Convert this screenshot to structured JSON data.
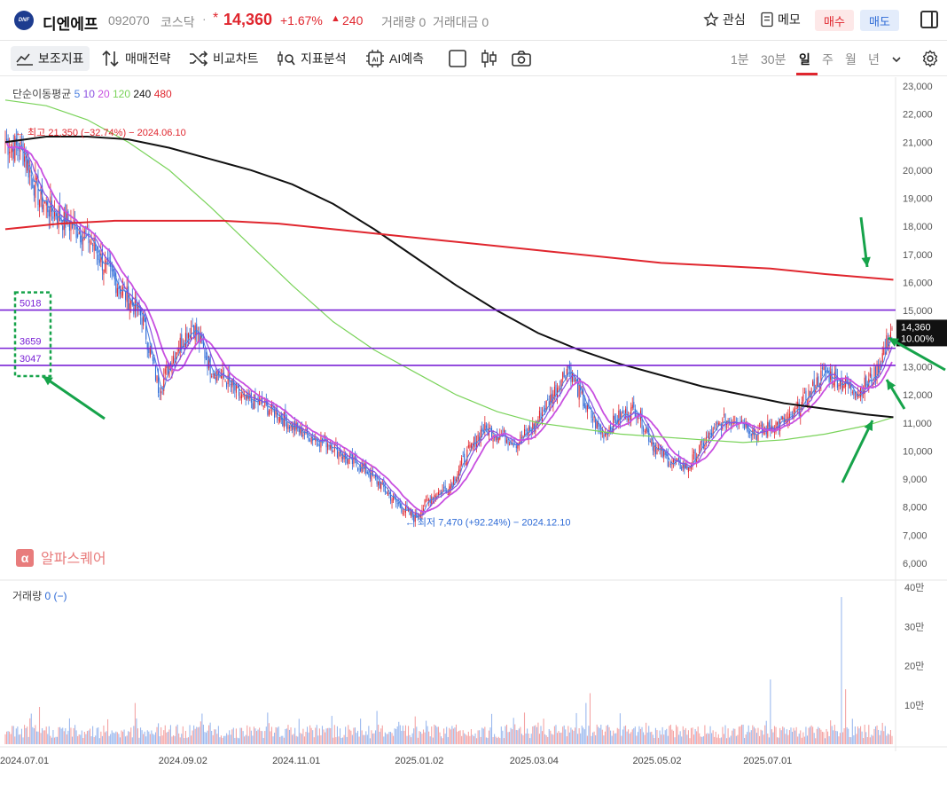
{
  "header": {
    "logo_text": "DNF",
    "stock_name": "디엔에프",
    "stock_code": "092070",
    "market": "코스닥",
    "separator": "·",
    "price_prefix": "*",
    "price": "14,360",
    "change_pct": "+1.67%",
    "change_arrow": "▲",
    "change": "240",
    "volume_text": "거래량 0",
    "amount_text": "거래대금 0",
    "watch_label": "관심",
    "memo_label": "메모",
    "buy_label": "매수",
    "sell_label": "매도"
  },
  "toolbar": {
    "indicator_label": "보조지표",
    "strategy_label": "매매전략",
    "compare_label": "비교차트",
    "analysis_label": "지표분석",
    "ai_label": "AI예측",
    "ai_icon_text": "AI",
    "timeframes": [
      "1분",
      "30분",
      "일",
      "주",
      "월",
      "년"
    ],
    "active_timeframe": "일"
  },
  "chart_data": {
    "type": "candlestick",
    "ma_legend": {
      "title": "단순이동평균",
      "periods": [
        {
          "label": "5",
          "color": "#4a7fe0"
        },
        {
          "label": "10",
          "color": "#8a4fe0"
        },
        {
          "label": "20",
          "color": "#c84fe0"
        },
        {
          "label": "120",
          "color": "#7ad35a"
        },
        {
          "label": "240",
          "color": "#111111"
        },
        {
          "label": "480",
          "color": "#e0262e"
        }
      ]
    },
    "ylim": [
      6000,
      23000
    ],
    "y_ticks": [
      "23,000",
      "22,000",
      "21,000",
      "20,000",
      "19,000",
      "18,000",
      "17,000",
      "16,000",
      "15,000",
      "14,000",
      "13,000",
      "12,000",
      "11,000",
      "10,000",
      "9,000",
      "8,000",
      "7,000",
      "6,000"
    ],
    "x_ticks": [
      "2024.07.01",
      "2024.09.02",
      "2024.11.01",
      "2025.01.02",
      "2025.03.04",
      "2025.05.02",
      "2025.07.01"
    ],
    "current_price_label": "14,360",
    "current_pct_label": "10.00%",
    "high_annotation": "최고 21,350 (−32.74%) − 2024.06.10",
    "low_annotation": "최저 7,470 (+92.24%) − 2024.12.10",
    "horizontal_lines": [
      {
        "label": "5018",
        "value": 15018
      },
      {
        "label": "3659",
        "value": 13659
      },
      {
        "label": "3047",
        "value": 13047
      }
    ],
    "close_anchors": [
      21000,
      20700,
      19000,
      18400,
      18000,
      17500,
      16400,
      15600,
      14800,
      12200,
      13600,
      14500,
      13000,
      12500,
      11800,
      11700,
      11300,
      10800,
      10500,
      10300,
      9700,
      9400,
      8800,
      8100,
      7600,
      8400,
      8700,
      9800,
      10800,
      10600,
      10300,
      10900,
      11900,
      13000,
      11600,
      10600,
      11200,
      11500,
      10200,
      9600,
      9400,
      10300,
      11000,
      11200,
      10600,
      10900,
      11100,
      11900,
      12800,
      12500,
      12100,
      12700,
      14360
    ],
    "ma120": [
      [
        0,
        22500
      ],
      [
        30,
        22300
      ],
      [
        60,
        21800
      ],
      [
        90,
        21000
      ],
      [
        120,
        20000
      ],
      [
        150,
        18700
      ],
      [
        180,
        17300
      ],
      [
        210,
        15900
      ],
      [
        240,
        14600
      ],
      [
        270,
        13600
      ],
      [
        300,
        12800
      ],
      [
        330,
        12000
      ],
      [
        360,
        11400
      ],
      [
        390,
        11000
      ],
      [
        420,
        10800
      ],
      [
        450,
        10600
      ],
      [
        480,
        10500
      ],
      [
        510,
        10400
      ],
      [
        540,
        10300
      ],
      [
        570,
        10400
      ],
      [
        600,
        10600
      ],
      [
        630,
        10900
      ],
      [
        650,
        11200
      ]
    ],
    "ma240": [
      [
        0,
        21000
      ],
      [
        30,
        21200
      ],
      [
        60,
        21200
      ],
      [
        90,
        21100
      ],
      [
        120,
        20800
      ],
      [
        150,
        20400
      ],
      [
        180,
        20000
      ],
      [
        210,
        19500
      ],
      [
        240,
        18800
      ],
      [
        270,
        17900
      ],
      [
        300,
        16900
      ],
      [
        330,
        15900
      ],
      [
        360,
        15000
      ],
      [
        390,
        14200
      ],
      [
        420,
        13600
      ],
      [
        450,
        13100
      ],
      [
        480,
        12700
      ],
      [
        510,
        12300
      ],
      [
        540,
        12000
      ],
      [
        570,
        11700
      ],
      [
        600,
        11500
      ],
      [
        630,
        11300
      ],
      [
        650,
        11200
      ]
    ],
    "ma480": [
      [
        0,
        17900
      ],
      [
        40,
        18100
      ],
      [
        80,
        18200
      ],
      [
        120,
        18200
      ],
      [
        160,
        18200
      ],
      [
        200,
        18100
      ],
      [
        240,
        17900
      ],
      [
        280,
        17700
      ],
      [
        320,
        17500
      ],
      [
        360,
        17300
      ],
      [
        400,
        17100
      ],
      [
        440,
        16900
      ],
      [
        480,
        16700
      ],
      [
        520,
        16600
      ],
      [
        560,
        16500
      ],
      [
        600,
        16300
      ],
      [
        650,
        16100
      ]
    ],
    "volume": {
      "label": "거래량",
      "value_text": "0 (−)",
      "ylim": [
        0,
        400000
      ],
      "y_ticks": [
        "40만",
        "30만",
        "20만",
        "10만"
      ],
      "spikes": [
        {
          "i": 25,
          "v": 95000
        },
        {
          "i": 95,
          "v": 105000
        },
        {
          "i": 150,
          "v": 55000
        },
        {
          "i": 230,
          "v": 40000
        },
        {
          "i": 330,
          "v": 50000
        },
        {
          "i": 390,
          "v": 55000
        },
        {
          "i": 425,
          "v": 105000
        },
        {
          "i": 428,
          "v": 130000
        },
        {
          "i": 560,
          "v": 165000
        },
        {
          "i": 612,
          "v": 375000
        },
        {
          "i": 615,
          "v": 140000
        }
      ]
    }
  },
  "watermark": "알파스퀘어",
  "watermark_glyph": "α"
}
